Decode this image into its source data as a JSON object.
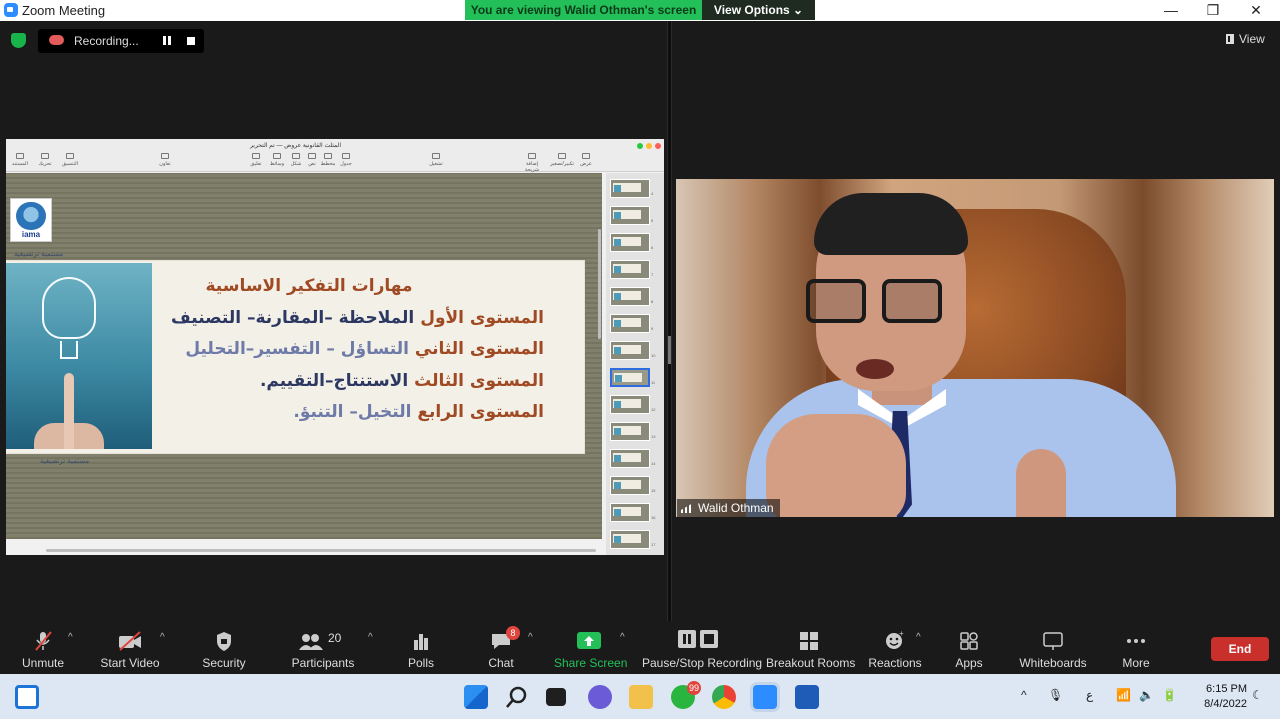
{
  "window": {
    "title": "Zoom Meeting",
    "minimize": "—",
    "restore": "❐",
    "close": "✕"
  },
  "banner": {
    "message": "You are viewing Walid Othman's screen",
    "options": "View Options ⌄"
  },
  "recording": {
    "label": "Recording..."
  },
  "view": {
    "label": "View"
  },
  "shared": {
    "doc_title": "المثلث القانونية عروض — تم التحرير",
    "toolbar_right": [
      {
        "label": "عرض"
      },
      {
        "label": "تكبير/تصغير"
      },
      {
        "label": "إضافة شريحة"
      }
    ],
    "toolbar_mid": [
      {
        "label": "تشغيل"
      }
    ],
    "toolbar_left": [
      {
        "label": "جدول"
      },
      {
        "label": "مخطط"
      },
      {
        "label": "نص"
      },
      {
        "label": "شكل"
      },
      {
        "label": "وسائط"
      },
      {
        "label": "تعليق"
      }
    ],
    "toolbar_far_left": [
      {
        "label": "تعاون"
      },
      {
        "label": "التنسيق"
      },
      {
        "label": "تحريك"
      },
      {
        "label": "المستند"
      }
    ],
    "logo_text": "iama",
    "logo_caption": "مستمية ترتصيغية",
    "slide_caption": "مستمية ترتصيغية",
    "slide": {
      "heading": "مهارات التفكير الاساسية",
      "lines": [
        {
          "label": "المستوى الأول",
          "text": "الملاحظة –المقارنة– التصنيف"
        },
        {
          "label": "المستوى الثاني",
          "text": "التساؤل – التفسير–التحليل"
        },
        {
          "label": "المستوى الثالث",
          "text": "الاستنتاج–التقييم."
        },
        {
          "label": "المستوى الرابع",
          "text": "التخيل– التنبؤ."
        }
      ]
    },
    "thumb_numbers": [
      "4",
      "5",
      "6",
      "7",
      "8",
      "9",
      "10",
      "11",
      "12",
      "13",
      "14",
      "15",
      "16",
      "17"
    ],
    "selected_thumb": "11"
  },
  "video": {
    "participant_name": "Walid Othman"
  },
  "toolbar": {
    "unmute": "Unmute",
    "start_video": "Start Video",
    "security": "Security",
    "participants": "Participants",
    "participants_count": "20",
    "polls": "Polls",
    "chat": "Chat",
    "chat_badge": "8",
    "share_screen": "Share Screen",
    "pause_stop": "Pause/Stop Recording",
    "breakout": "Breakout Rooms",
    "reactions": "Reactions",
    "apps": "Apps",
    "whiteboards": "Whiteboards",
    "more": "More",
    "end": "End"
  },
  "taskbar": {
    "whatsapp_badge": "99",
    "lang": "ع",
    "time": "6:15 PM",
    "date": "8/4/2022"
  },
  "colors": {
    "share_green": "#23c059",
    "end_red": "#c9302c",
    "accent_blue": "#2d8cff"
  }
}
